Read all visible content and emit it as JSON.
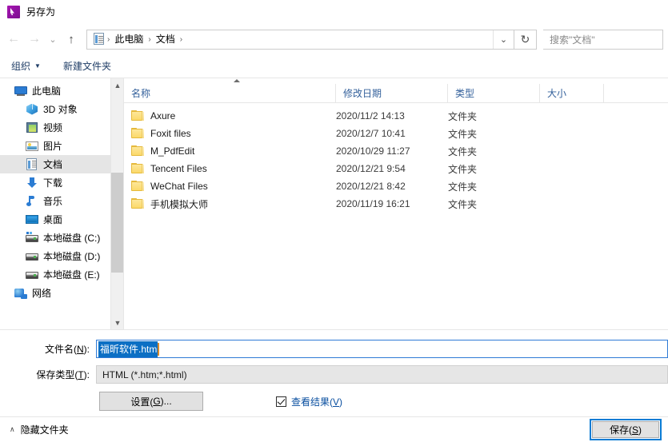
{
  "window": {
    "title": "另存为",
    "app_icon": "pdf-editor-icon",
    "accent_color": "#0a7cd4",
    "selection_color": "#0b6fc4"
  },
  "navbar": {
    "back_icon": "arrow-left-icon",
    "forward_icon": "arrow-right-icon",
    "recent_icon": "chevron-down-icon",
    "up_icon": "arrow-up-icon",
    "breadcrumb_icon": "documents-icon",
    "breadcrumbs": [
      "此电脑",
      "文档"
    ],
    "separator": "›",
    "address_dropdown_icon": "chevron-down-icon",
    "refresh_icon": "refresh-icon",
    "search_placeholder": "搜索\"文档\""
  },
  "command_bar": {
    "organize_label": "组织",
    "organize_caret": "▼",
    "new_folder_label": "新建文件夹"
  },
  "sidebar": {
    "scroll_up_icon": "chevron-up-icon",
    "scroll_down_icon": "chevron-down-icon",
    "items": [
      {
        "label": "此电脑",
        "icon": "computer-icon",
        "level": 0,
        "selected": false
      },
      {
        "label": "3D 对象",
        "icon": "3d-objects-icon",
        "level": 1,
        "selected": false
      },
      {
        "label": "视频",
        "icon": "videos-icon",
        "level": 1,
        "selected": false
      },
      {
        "label": "图片",
        "icon": "pictures-icon",
        "level": 1,
        "selected": false
      },
      {
        "label": "文档",
        "icon": "documents-icon",
        "level": 1,
        "selected": true
      },
      {
        "label": "下载",
        "icon": "downloads-icon",
        "level": 1,
        "selected": false
      },
      {
        "label": "音乐",
        "icon": "music-icon",
        "level": 1,
        "selected": false
      },
      {
        "label": "桌面",
        "icon": "desktop-icon",
        "level": 1,
        "selected": false
      },
      {
        "label": "本地磁盘 (C:)",
        "icon": "system-drive-icon",
        "level": 1,
        "selected": false
      },
      {
        "label": "本地磁盘 (D:)",
        "icon": "drive-icon",
        "level": 1,
        "selected": false
      },
      {
        "label": "本地磁盘 (E:)",
        "icon": "drive-icon",
        "level": 1,
        "selected": false
      },
      {
        "label": "网络",
        "icon": "network-icon",
        "level": 0,
        "selected": false
      }
    ]
  },
  "filelist": {
    "sort_indicator": "ascending-caret-icon",
    "columns": [
      "名称",
      "修改日期",
      "类型",
      "大小"
    ],
    "rows": [
      {
        "icon": "folder-icon",
        "name": "Axure",
        "date": "2020/11/2 14:13",
        "type": "文件夹",
        "size": ""
      },
      {
        "icon": "folder-icon",
        "name": "Foxit files",
        "date": "2020/12/7 10:41",
        "type": "文件夹",
        "size": ""
      },
      {
        "icon": "folder-icon",
        "name": "M_PdfEdit",
        "date": "2020/10/29 11:27",
        "type": "文件夹",
        "size": ""
      },
      {
        "icon": "folder-icon",
        "name": "Tencent Files",
        "date": "2020/12/21 9:54",
        "type": "文件夹",
        "size": ""
      },
      {
        "icon": "folder-icon",
        "name": "WeChat Files",
        "date": "2020/12/21 8:42",
        "type": "文件夹",
        "size": ""
      },
      {
        "icon": "folder-icon",
        "name": "手机模拟大师",
        "date": "2020/11/19 16:21",
        "type": "文件夹",
        "size": ""
      }
    ]
  },
  "form": {
    "filename_label_pre": "文件名(",
    "filename_label_key": "N",
    "filename_label_post": "):",
    "filename_value": "福昕软件.htm",
    "filetype_label_pre": "保存类型(",
    "filetype_label_key": "T",
    "filetype_label_post": "):",
    "filetype_value": "HTML (*.htm;*.html)",
    "settings_label_pre": "设置(",
    "settings_label_key": "G",
    "settings_label_post": ")...",
    "view_result_pre": "查看结果(",
    "view_result_key": "V",
    "view_result_post": ")",
    "view_result_checked": true,
    "checkbox_icon": "checkbox-checked-icon"
  },
  "footer": {
    "hide_folders_icon": "chevron-up-icon",
    "hide_folders_label": "隐藏文件夹",
    "save_label_pre": "保存(",
    "save_label_key": "S",
    "save_label_post": ")"
  }
}
